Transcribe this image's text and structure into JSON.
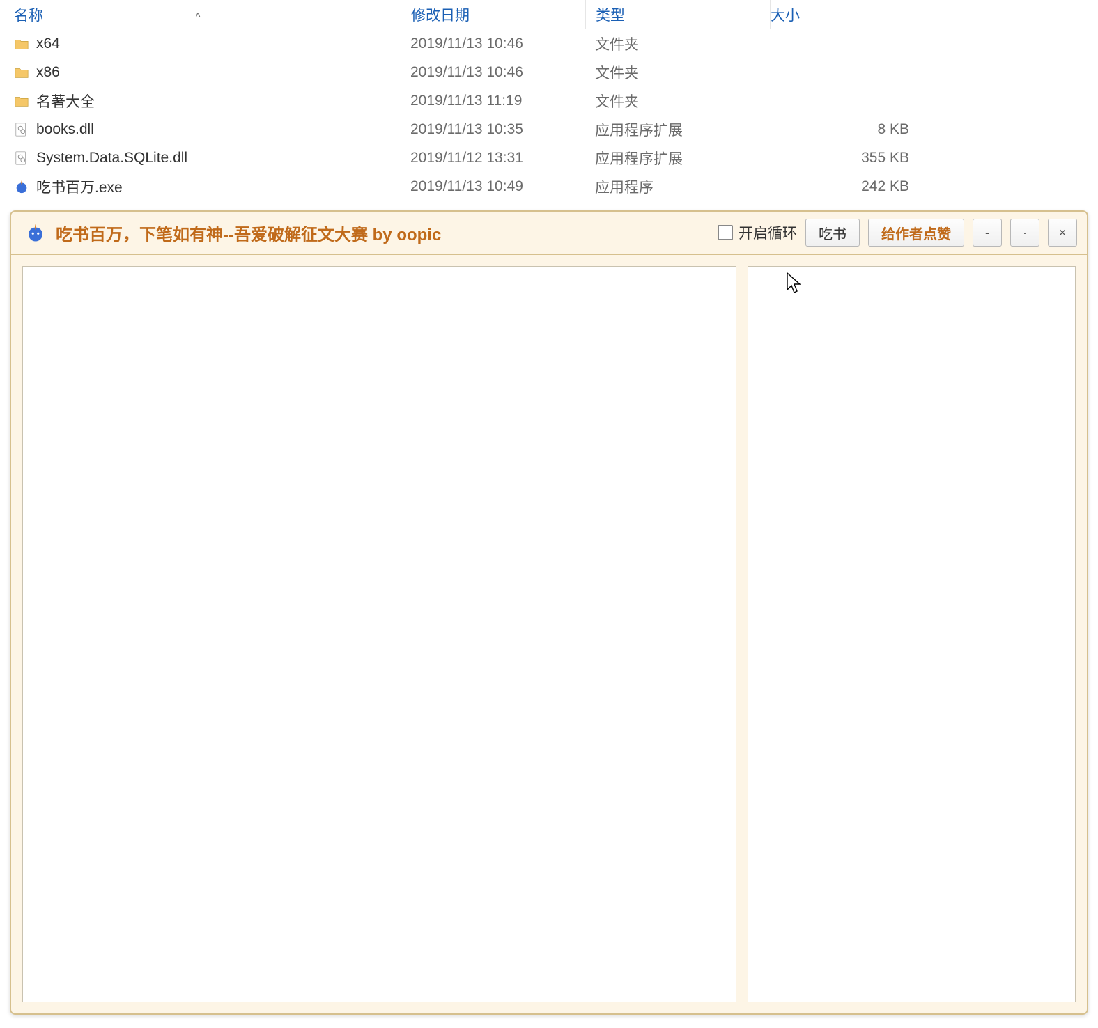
{
  "explorer": {
    "columns": {
      "name": "名称",
      "date": "修改日期",
      "type": "类型",
      "size": "大小"
    },
    "rows": [
      {
        "icon": "folder",
        "name": "x64",
        "date": "2019/11/13 10:46",
        "type": "文件夹",
        "size": ""
      },
      {
        "icon": "folder",
        "name": "x86",
        "date": "2019/11/13 10:46",
        "type": "文件夹",
        "size": ""
      },
      {
        "icon": "folder",
        "name": "名著大全",
        "date": "2019/11/13 11:19",
        "type": "文件夹",
        "size": ""
      },
      {
        "icon": "dll",
        "name": "books.dll",
        "date": "2019/11/13 10:35",
        "type": "应用程序扩展",
        "size": "8 KB"
      },
      {
        "icon": "dll",
        "name": "System.Data.SQLite.dll",
        "date": "2019/11/12 13:31",
        "type": "应用程序扩展",
        "size": "355 KB"
      },
      {
        "icon": "exe",
        "name": "吃书百万.exe",
        "date": "2019/11/13 10:49",
        "type": "应用程序",
        "size": "242 KB"
      }
    ]
  },
  "app": {
    "title": "吃书百万，下笔如有神--吾爱破解征文大赛 by oopic",
    "loop_label": "开启循环",
    "loop_checked": false,
    "eat_label": "吃书",
    "praise_label": "给作者点赞",
    "minimize_label": "-",
    "maximize_label": "·",
    "close_label": "×"
  }
}
